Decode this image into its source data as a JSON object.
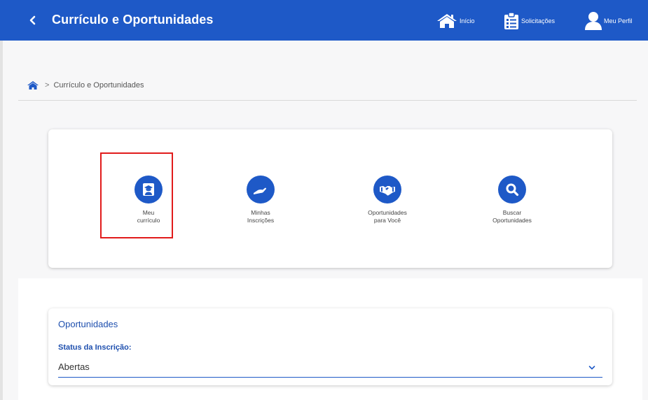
{
  "header": {
    "title": "Currículo e Oportunidades",
    "nav": [
      {
        "label": "Início",
        "icon": "home-icon"
      },
      {
        "label": "Solicitações",
        "icon": "clipboard-icon"
      },
      {
        "label": "Meu Perfil",
        "icon": "user-icon"
      }
    ]
  },
  "breadcrumb": {
    "current": "Currículo e Oportunidades",
    "separator": ">"
  },
  "shortcuts": [
    {
      "label": "Meu\ncurrículo",
      "icon": "graduate-icon"
    },
    {
      "label": "Minhas\nInscrições",
      "icon": "hand-icon"
    },
    {
      "label": "Oportunidades\npara Você",
      "icon": "handshake-icon"
    },
    {
      "label": "Buscar\nOportunidades",
      "icon": "search-icon"
    }
  ],
  "opportunities": {
    "title": "Oportunidades",
    "status_label": "Status da Inscrição:",
    "status_value": "Abertas"
  },
  "colors": {
    "primary": "#1e59c7",
    "highlight": "#e11b1b"
  }
}
